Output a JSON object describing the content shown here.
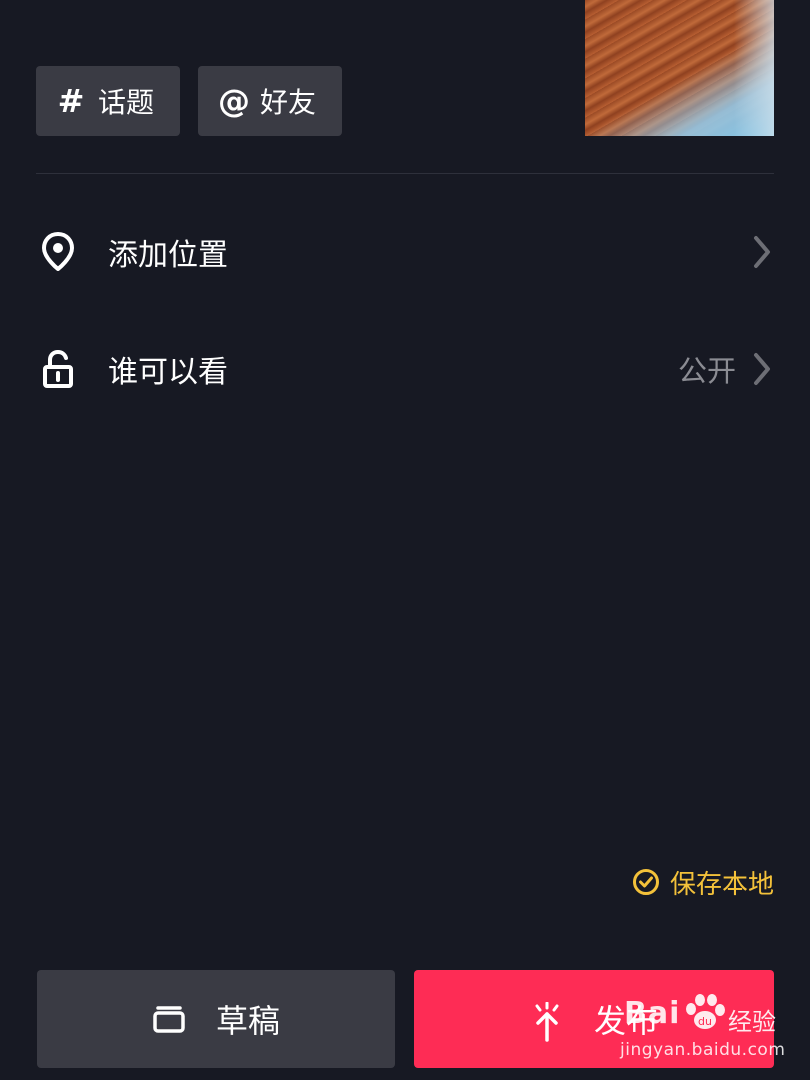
{
  "tags": {
    "topic_symbol": "#",
    "topic_label": "话题",
    "friend_symbol": "@",
    "friend_label": "好友"
  },
  "settings": {
    "location": {
      "label": "添加位置",
      "icon": "location-pin-icon"
    },
    "visibility": {
      "label": "谁可以看",
      "value": "公开",
      "icon": "unlock-icon"
    }
  },
  "save_local": {
    "label": "保存本地",
    "checked": true,
    "color": "#f3c13a"
  },
  "actions": {
    "draft_label": "草稿",
    "publish_label": "发布"
  },
  "watermark": {
    "brand_left": "Bai",
    "brand_right": "经验",
    "url": "jingyan.baidu.com"
  },
  "colors": {
    "background": "#171923",
    "chip": "#3a3b44",
    "publish": "#fe2c55",
    "muted_text": "#8b8c93"
  }
}
